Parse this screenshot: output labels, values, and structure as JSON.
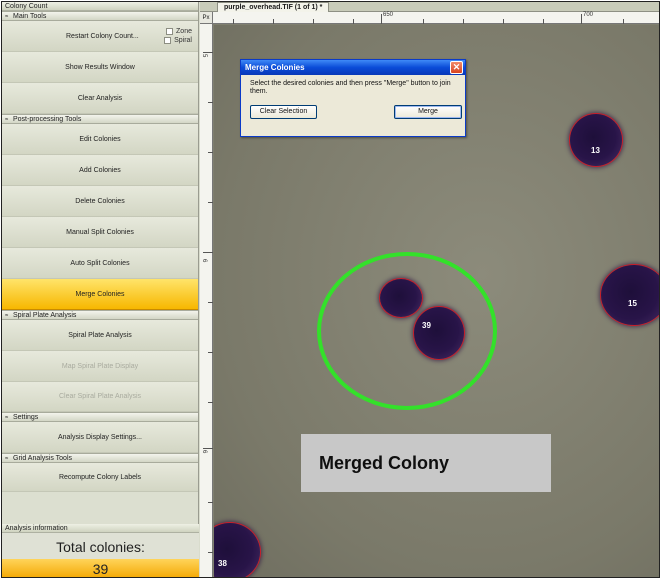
{
  "panel": {
    "title": "Colony Count",
    "main_tools": {
      "header": "Main Tools",
      "restart_label": "Restart Colony Count...",
      "zone_label": "Zone",
      "spiral_label": "Spiral",
      "show_results_label": "Show Results Window",
      "clear_analysis_label": "Clear Analysis"
    },
    "post_processing": {
      "header": "Post-processing Tools",
      "items": [
        {
          "label": "Edit Colonies"
        },
        {
          "label": "Add Colonies"
        },
        {
          "label": "Delete Colonies"
        },
        {
          "label": "Manual Split Colonies"
        },
        {
          "label": "Auto Split Colonies"
        },
        {
          "label": "Merge Colonies"
        }
      ]
    },
    "spiral": {
      "header": "Spiral Plate Analysis",
      "items": [
        {
          "label": "Spiral Plate Analysis"
        },
        {
          "label": "Map Spiral Plate Display"
        },
        {
          "label": "Clear Spiral Plate Analysis"
        }
      ]
    },
    "settings": {
      "header": "Settings",
      "display_settings_label": "Analysis Display Settings..."
    },
    "grid": {
      "header": "Grid Analysis Tools",
      "recompute_label": "Recompute Colony Labels"
    },
    "analysis_info": {
      "header": "Analysis information",
      "total_label": "Total colonies:",
      "total_value": "39"
    }
  },
  "document": {
    "tab_label": "purple_overhead.TIF (1 of 1) *",
    "ruler_unit": "Px",
    "ruler_top_labels": [
      "650",
      "700"
    ],
    "ruler_left_labels": [
      "5",
      "6",
      "6",
      "6"
    ]
  },
  "colonies": [
    {
      "label": "13"
    },
    {
      "label": "15"
    },
    {
      "label": "39"
    },
    {
      "label": "38"
    }
  ],
  "dialog": {
    "title": "Merge Colonies",
    "message": "Select the desired colonies and then press \"Merge\" button to join them.",
    "clear_label": "Clear Selection",
    "merge_label": "Merge",
    "close_glyph": "✕"
  },
  "overlay": {
    "merged_label": "Merged Colony"
  },
  "colors": {
    "accent": "#f7b700",
    "highlight_circle": "#33e12a",
    "colony_outline": "#c81e2a",
    "dialog_title": "#0a4bd8"
  }
}
